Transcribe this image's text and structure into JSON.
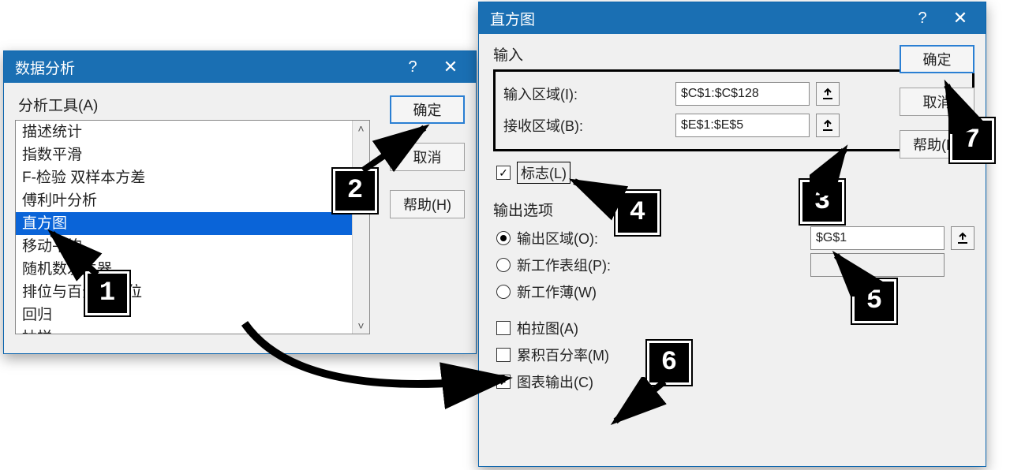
{
  "left": {
    "title": "数据分析",
    "tools_label": "分析工具(A)",
    "items": [
      "描述统计",
      "指数平滑",
      "F-检验 双样本方差",
      "傅利叶分析",
      "直方图",
      "移动平均",
      "随机数发生器",
      "排位与百分比排位",
      "回归",
      "抽样"
    ],
    "selected_index": 4,
    "buttons": {
      "ok": "确定",
      "cancel": "取消",
      "help": "帮助(H)"
    }
  },
  "right": {
    "title": "直方图",
    "input_group": "输入",
    "input_range_label": "输入区域(I):",
    "input_range_value": "$C$1:$C$128",
    "bin_range_label": "接收区域(B):",
    "bin_range_value": "$E$1:$E$5",
    "labels_checkbox": "标志(L)",
    "output_group": "输出选项",
    "out_range_label": "输出区域(O):",
    "out_range_value": "$G$1",
    "new_sheet_label": "新工作表组(P):",
    "new_book_label": "新工作薄(W)",
    "pareto_label": "柏拉图(A)",
    "cum_pct_label": "累积百分率(M)",
    "chart_out_label": "图表输出(C)",
    "buttons": {
      "ok": "确定",
      "cancel": "取消",
      "help": "帮助(H)"
    }
  },
  "callouts": {
    "c1": "1",
    "c2": "2",
    "c3": "3",
    "c4": "4",
    "c5": "5",
    "c6": "6",
    "c7": "7"
  }
}
